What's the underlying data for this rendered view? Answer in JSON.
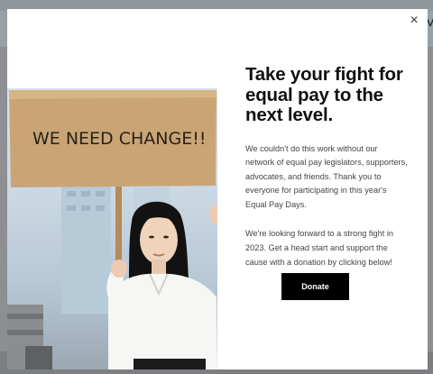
{
  "modal": {
    "headline": "Take your fight for equal pay to the next level.",
    "paragraph1": "We couldn't do this work without our network of equal pay legislators, supporters, advocates, and friends. Thank you to everyone for participating in this year's Equal Pay Days.",
    "paragraph2": "We're looking forward to a strong fight in 2023. Get a head start and support the cause with a donation by clicking below!",
    "donate_label": "Donate",
    "close_label": "×",
    "sign_text": "WE NEED CHANGE!!"
  },
  "background": {
    "peek_char": "V"
  },
  "colors": {
    "headline": "#111111",
    "body_text": "#444444",
    "button_bg": "#000000",
    "button_text": "#ffffff",
    "overlay": "#8e8f93"
  },
  "icons": {
    "close": "close-icon"
  }
}
